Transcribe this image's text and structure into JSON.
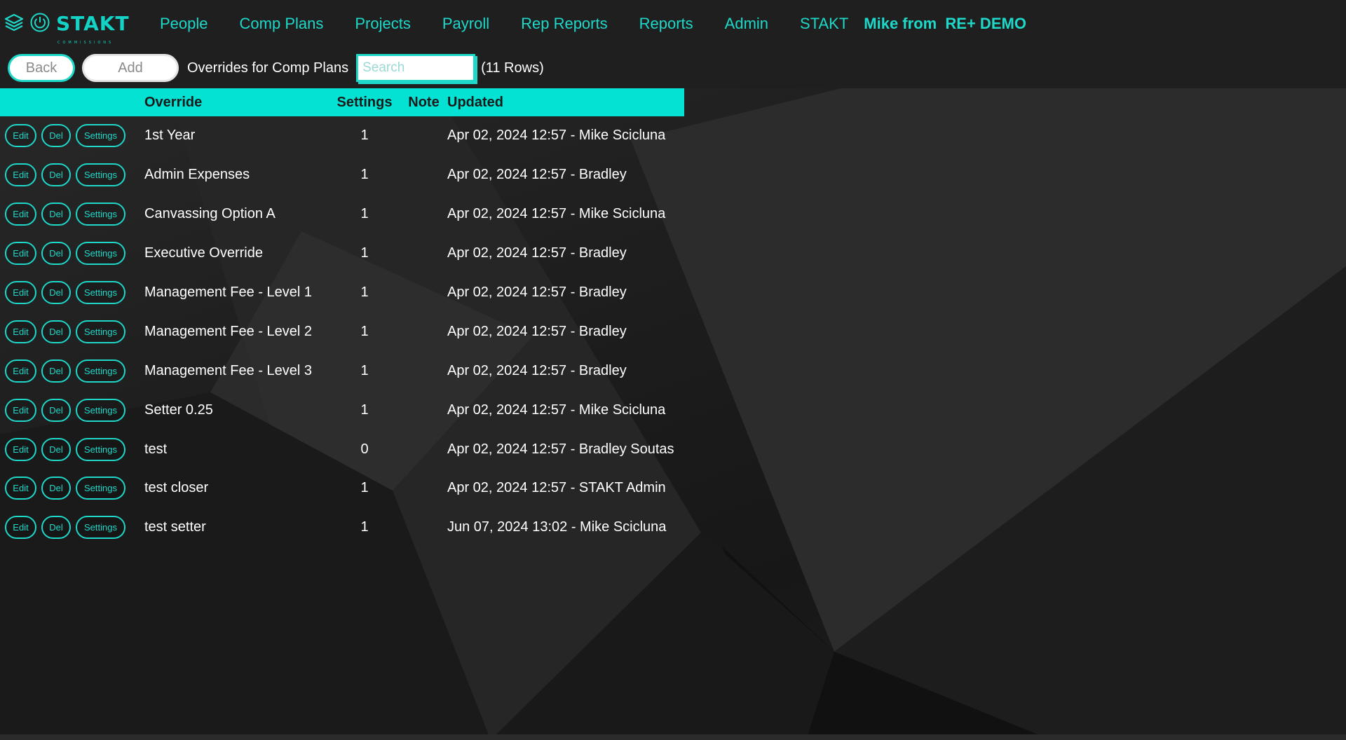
{
  "nav": {
    "brand": "STAKT",
    "brand_sub": "COMMISSIONS",
    "links": [
      "People",
      "Comp Plans",
      "Projects",
      "Payroll",
      "Rep Reports",
      "Reports",
      "Admin",
      "STAKT"
    ],
    "user": "Mike from  RE+ DEMO"
  },
  "toolbar": {
    "back_label": "Back",
    "add_label": "Add",
    "title": "Overrides for Comp Plans",
    "search_placeholder": "Search",
    "rows_count": "(11 Rows)"
  },
  "table": {
    "headers": {
      "override": "Override",
      "settings": "Settings",
      "note": "Note",
      "updated": "Updated"
    },
    "action_labels": {
      "edit": "Edit",
      "del": "Del",
      "settings": "Settings"
    },
    "rows": [
      {
        "override": "1st Year",
        "settings": "1",
        "note": "",
        "updated": "Apr 02, 2024 12:57 - Mike Scicluna"
      },
      {
        "override": "Admin Expenses",
        "settings": "1",
        "note": "",
        "updated": "Apr 02, 2024 12:57 - Bradley"
      },
      {
        "override": "Canvassing Option A",
        "settings": "1",
        "note": "",
        "updated": "Apr 02, 2024 12:57 - Mike Scicluna"
      },
      {
        "override": "Executive Override",
        "settings": "1",
        "note": "",
        "updated": "Apr 02, 2024 12:57 - Bradley"
      },
      {
        "override": "Management Fee - Level 1",
        "settings": "1",
        "note": "",
        "updated": "Apr 02, 2024 12:57 - Bradley"
      },
      {
        "override": "Management Fee - Level 2",
        "settings": "1",
        "note": "",
        "updated": "Apr 02, 2024 12:57 - Bradley"
      },
      {
        "override": "Management Fee - Level 3",
        "settings": "1",
        "note": "",
        "updated": "Apr 02, 2024 12:57 - Bradley"
      },
      {
        "override": "Setter 0.25",
        "settings": "1",
        "note": "",
        "updated": "Apr 02, 2024 12:57 - Mike Scicluna"
      },
      {
        "override": "test",
        "settings": "0",
        "note": "",
        "updated": "Apr 02, 2024 12:57 - Bradley Soutas"
      },
      {
        "override": "test closer",
        "settings": "1",
        "note": "",
        "updated": "Apr 02, 2024 12:57 - STAKT Admin"
      },
      {
        "override": "test setter",
        "settings": "1",
        "note": "",
        "updated": "Jun 07, 2024 13:02 - Mike Scicluna"
      }
    ]
  },
  "colors": {
    "accent": "#04e2d3",
    "link": "#1ed8c9",
    "background": "#1c1c1c"
  },
  "icons": [
    "layers-icon",
    "power-icon"
  ]
}
